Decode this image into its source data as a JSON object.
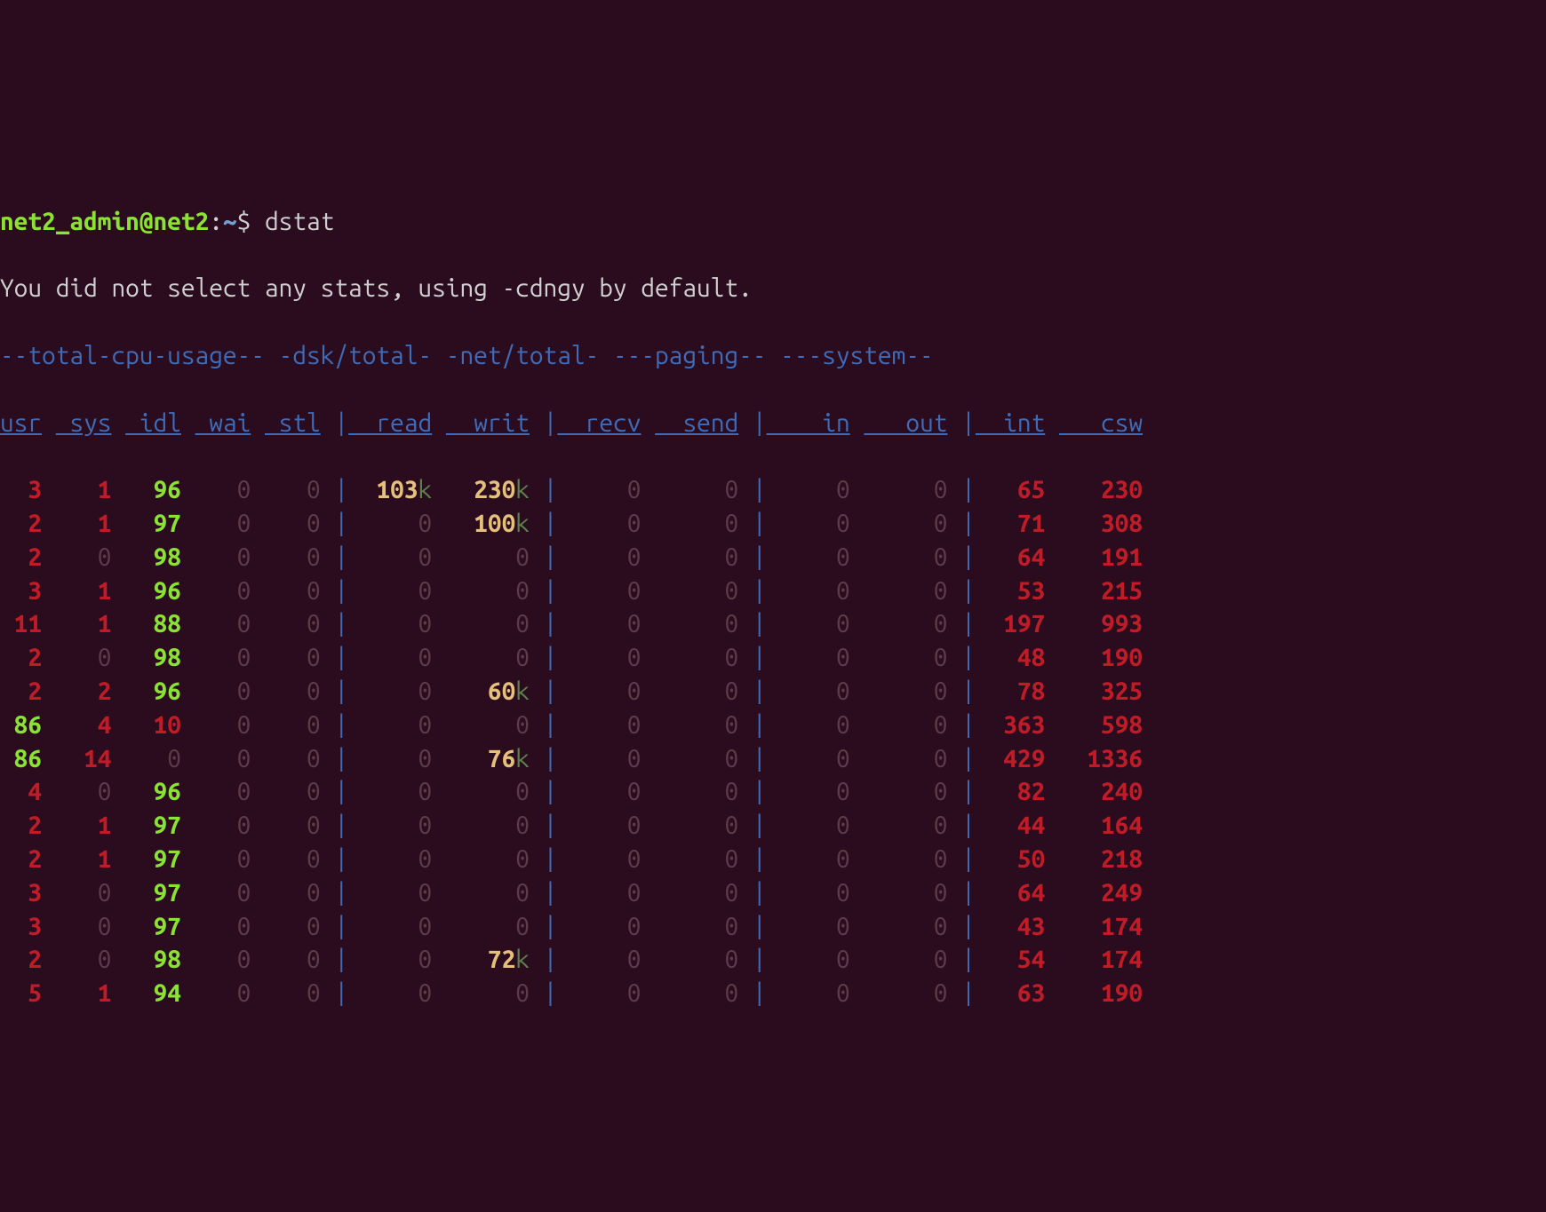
{
  "prompt": {
    "user": "net2_admin",
    "at": "@",
    "host": "net2",
    "colon": ":",
    "path": "~",
    "dollar": "$",
    "command": "dstat"
  },
  "message": "You did not select any stats, using -cdngy by default.",
  "sections": {
    "cpu": "--total-cpu-usage--",
    "dsk": "-dsk/total-",
    "net": "-net/total-",
    "pag": "---paging--",
    "sys": "---system--"
  },
  "columns": {
    "usr": "usr",
    "sys": "sys",
    "idl": "idl",
    "wai": "wai",
    "stl": "stl",
    "read": "read",
    "writ": "writ",
    "recv": "recv",
    "send": "send",
    "in": "in",
    "out": "out",
    "int": "int",
    "csw": "csw"
  },
  "rows": [
    {
      "usr": "3",
      "sys": "1",
      "idl": "96",
      "wai": "0",
      "stl": "0",
      "read": "103",
      "read_u": "k",
      "writ": "230",
      "writ_u": "k",
      "recv": "0",
      "send": "0",
      "in": "0",
      "out": "0",
      "int": "65",
      "csw": "230"
    },
    {
      "usr": "2",
      "sys": "1",
      "idl": "97",
      "wai": "0",
      "stl": "0",
      "read": "0",
      "read_u": "",
      "writ": "100",
      "writ_u": "k",
      "recv": "0",
      "send": "0",
      "in": "0",
      "out": "0",
      "int": "71",
      "csw": "308"
    },
    {
      "usr": "2",
      "sys": "0",
      "idl": "98",
      "wai": "0",
      "stl": "0",
      "read": "0",
      "read_u": "",
      "writ": "0",
      "writ_u": "",
      "recv": "0",
      "send": "0",
      "in": "0",
      "out": "0",
      "int": "64",
      "csw": "191"
    },
    {
      "usr": "3",
      "sys": "1",
      "idl": "96",
      "wai": "0",
      "stl": "0",
      "read": "0",
      "read_u": "",
      "writ": "0",
      "writ_u": "",
      "recv": "0",
      "send": "0",
      "in": "0",
      "out": "0",
      "int": "53",
      "csw": "215"
    },
    {
      "usr": "11",
      "sys": "1",
      "idl": "88",
      "wai": "0",
      "stl": "0",
      "read": "0",
      "read_u": "",
      "writ": "0",
      "writ_u": "",
      "recv": "0",
      "send": "0",
      "in": "0",
      "out": "0",
      "int": "197",
      "csw": "993"
    },
    {
      "usr": "2",
      "sys": "0",
      "idl": "98",
      "wai": "0",
      "stl": "0",
      "read": "0",
      "read_u": "",
      "writ": "0",
      "writ_u": "",
      "recv": "0",
      "send": "0",
      "in": "0",
      "out": "0",
      "int": "48",
      "csw": "190"
    },
    {
      "usr": "2",
      "sys": "2",
      "idl": "96",
      "wai": "0",
      "stl": "0",
      "read": "0",
      "read_u": "",
      "writ": "60",
      "writ_u": "k",
      "recv": "0",
      "send": "0",
      "in": "0",
      "out": "0",
      "int": "78",
      "csw": "325"
    },
    {
      "usr": "86",
      "sys": "4",
      "idl": "10",
      "wai": "0",
      "stl": "0",
      "read": "0",
      "read_u": "",
      "writ": "0",
      "writ_u": "",
      "recv": "0",
      "send": "0",
      "in": "0",
      "out": "0",
      "int": "363",
      "csw": "598"
    },
    {
      "usr": "86",
      "sys": "14",
      "idl": "0",
      "wai": "0",
      "stl": "0",
      "read": "0",
      "read_u": "",
      "writ": "76",
      "writ_u": "k",
      "recv": "0",
      "send": "0",
      "in": "0",
      "out": "0",
      "int": "429",
      "csw": "1336"
    },
    {
      "usr": "4",
      "sys": "0",
      "idl": "96",
      "wai": "0",
      "stl": "0",
      "read": "0",
      "read_u": "",
      "writ": "0",
      "writ_u": "",
      "recv": "0",
      "send": "0",
      "in": "0",
      "out": "0",
      "int": "82",
      "csw": "240"
    },
    {
      "usr": "2",
      "sys": "1",
      "idl": "97",
      "wai": "0",
      "stl": "0",
      "read": "0",
      "read_u": "",
      "writ": "0",
      "writ_u": "",
      "recv": "0",
      "send": "0",
      "in": "0",
      "out": "0",
      "int": "44",
      "csw": "164"
    },
    {
      "usr": "2",
      "sys": "1",
      "idl": "97",
      "wai": "0",
      "stl": "0",
      "read": "0",
      "read_u": "",
      "writ": "0",
      "writ_u": "",
      "recv": "0",
      "send": "0",
      "in": "0",
      "out": "0",
      "int": "50",
      "csw": "218"
    },
    {
      "usr": "3",
      "sys": "0",
      "idl": "97",
      "wai": "0",
      "stl": "0",
      "read": "0",
      "read_u": "",
      "writ": "0",
      "writ_u": "",
      "recv": "0",
      "send": "0",
      "in": "0",
      "out": "0",
      "int": "64",
      "csw": "249"
    },
    {
      "usr": "3",
      "sys": "0",
      "idl": "97",
      "wai": "0",
      "stl": "0",
      "read": "0",
      "read_u": "",
      "writ": "0",
      "writ_u": "",
      "recv": "0",
      "send": "0",
      "in": "0",
      "out": "0",
      "int": "43",
      "csw": "174"
    },
    {
      "usr": "2",
      "sys": "0",
      "idl": "98",
      "wai": "0",
      "stl": "0",
      "read": "0",
      "read_u": "",
      "writ": "72",
      "writ_u": "k",
      "recv": "0",
      "send": "0",
      "in": "0",
      "out": "0",
      "int": "54",
      "csw": "174"
    },
    {
      "usr": "5",
      "sys": "1",
      "idl": "94",
      "wai": "0",
      "stl": "0",
      "read": "0",
      "read_u": "",
      "writ": "0",
      "writ_u": "",
      "recv": "0",
      "send": "0",
      "in": "0",
      "out": "0",
      "int": "63",
      "csw": "190"
    }
  ],
  "colwidths": {
    "usr": 3,
    "sys": 4,
    "idl": 4,
    "wai": 4,
    "stl": 4,
    "read": 6,
    "writ": 6,
    "recv": 6,
    "send": 6,
    "in": 6,
    "out": 6,
    "int": 5,
    "csw": 6
  },
  "color_rules": {
    "usr": "mag",
    "sys": "mag",
    "idl": "idl",
    "wai": "dim",
    "stl": "dim",
    "read": "disk",
    "writ": "disk",
    "recv": "dim",
    "send": "dim",
    "in": "dim",
    "out": "dim",
    "int": "red",
    "csw": "red"
  }
}
